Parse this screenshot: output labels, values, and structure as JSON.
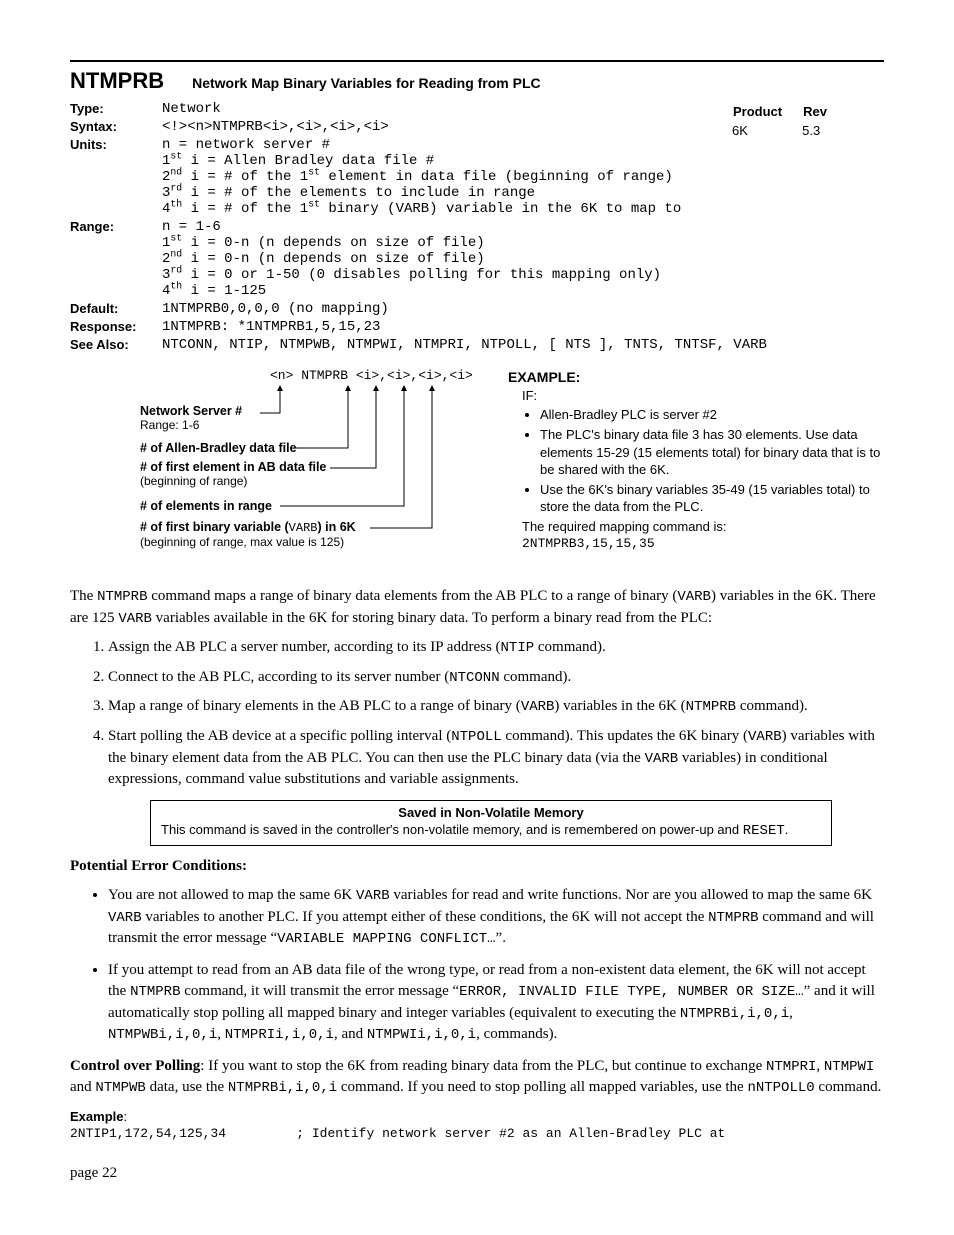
{
  "command": "NTMPRB",
  "title": "Network Map Binary Variables for Reading from PLC",
  "product": {
    "headerP": "Product",
    "headerR": "Rev",
    "prod": "6K",
    "rev": "5.3"
  },
  "spec": {
    "type_label": "Type:",
    "type_val": "Network",
    "syntax_label": "Syntax:",
    "syntax_val": "<!><n>NTMPRB<i>,<i>,<i>,<i>",
    "units_label": "Units:",
    "units_lines": [
      "n = network server #",
      "1st i = Allen Bradley data file #",
      "2nd i = # of the 1st element in data file (beginning of range)",
      "3rd i = # of the elements to include in range",
      "4th i = # of the 1st binary (VARB) variable in the 6K to map to"
    ],
    "range_label": "Range:",
    "range_lines": [
      "n = 1-6",
      "1st i = 0-n (n depends on size of file)",
      "2nd i = 0-n (n depends on size of file)",
      "3rd i = 0 or 1-50 (0 disables polling for this mapping only)",
      "4th i = 1-125"
    ],
    "default_label": "Default:",
    "default_val": "1NTMPRB0,0,0,0 (no mapping)",
    "response_label": "Response:",
    "response_val": "1NTMPRB:  *1NTMPRB1,5,15,23",
    "seealso_label": "See Also:",
    "seealso_val": "NTCONN, NTIP, NTMPWB, NTMPWI, NTMPRI, NTPOLL, [ NTS ], TNTS, TNTSF, VARB"
  },
  "diagram": {
    "syntax": "<n> NTMPRB <i>,<i>,<i>,<i>",
    "l1a": "Network Server #",
    "l1b": "Range: 1-6",
    "l2a": "# of Allen-Bradley data file",
    "l3a": "# of first element in AB data file",
    "l3b": "(beginning of range)",
    "l4a": "# of elements in range",
    "l5a": "# of first binary variable (",
    "l5cmd": "VARB",
    "l5b": ") in 6K",
    "l5c": "(beginning of range, max value is 125)"
  },
  "example": {
    "heading": "EXAMPLE:",
    "if": "IF:",
    "bullets": [
      "Allen-Bradley PLC is server #2",
      "The PLC's binary data file 3 has 30 elements. Use data elements 15-29 (15 elements total) for binary data that is to be shared with the 6K.",
      "Use the 6K's binary variables 35-49 (15 variables total) to store the data from the PLC."
    ],
    "req": "The required mapping command is:",
    "cmd": "2NTMPRB3,15,15,35"
  },
  "intro": {
    "p1a": "The ",
    "p1b": "NTMPRB",
    "p1c": " command maps a range of binary data elements from the AB PLC to a range of binary (",
    "p1d": "VARB",
    "p1e": ") variables in the 6K. There are 125 ",
    "p1f": "VARB",
    "p1g": " variables available in the 6K for storing binary data. To perform a binary read from the PLC:"
  },
  "steps": [
    {
      "a": "Assign the AB PLC a server number, according to its IP address (",
      "b": "NTIP",
      "c": " command)."
    },
    {
      "a": "Connect to the AB PLC, according to its server number (",
      "b": "NTCONN",
      "c": " command)."
    },
    {
      "a": "Map a range of binary elements in the AB PLC to a range of binary (",
      "b": "VARB",
      "c": ") variables in the 6K (",
      "d": "NTMPRB",
      "e": " command)."
    },
    {
      "a": "Start polling the AB device at a specific polling interval (",
      "b": "NTPOLL",
      "c": " command). This updates the 6K binary (",
      "d": "VARB",
      "e": ") variables with the binary element data from the AB PLC. You can then use the PLC binary data (via the ",
      "f": "VARB",
      "g": " variables) in conditional expressions, command value substitutions and variable assignments."
    }
  ],
  "nvbox": {
    "title": "Saved in Non-Volatile Memory",
    "body_a": "This command is saved in the controller's non-volatile memory, and is remembered on power-up and ",
    "body_b": "RESET",
    "body_c": "."
  },
  "errors": {
    "heading": "Potential Error Conditions:",
    "b1": {
      "a": "You are not allowed to map the same 6K ",
      "b": "VARB",
      "c": " variables for read and write functions. Nor are you allowed to map the same 6K ",
      "d": "VARB",
      "e": " variables to another PLC. If you attempt either of these conditions, the 6K will not accept the ",
      "f": "NTMPRB",
      "g": " command and will transmit the error message “",
      "h": "VARIABLE MAPPING CONFLICT…",
      "i": "”."
    },
    "b2": {
      "a": "If you attempt to read from an AB data file of the wrong type, or read from a non-existent data element, the 6K will not accept the ",
      "b": "NTMPRB",
      "c": " command, it will transmit the error message “",
      "d": "ERROR, INVALID FILE TYPE, NUMBER OR SIZE…",
      "e": "” and it will automatically stop polling all mapped binary and integer variables (equivalent to executing the ",
      "f": "NTMPRBi,i,0,i",
      "g": ", ",
      "h": "NTMPWBi,i,0,i",
      "i": ", ",
      "j": "NTMPRIi,i,0,i",
      "k": ", and ",
      "l": "NTMPWIi,i,0,i",
      "m": ", commands)."
    }
  },
  "polling": {
    "lead": "Control over Polling",
    "a": ": If you want to stop the 6K from reading binary data from the PLC, but continue to exchange ",
    "b": "NTMPRI",
    "c": ", ",
    "d": "NTMPWI",
    "e": " and ",
    "f": "NTMPWB",
    "g": " data, use the ",
    "h": "NTMPRBi,i,0,i",
    "i": " command. If you need to stop polling all mapped variables, use the ",
    "j": "nNTPOLL0",
    "k": " command."
  },
  "code_example": {
    "label": "Example",
    "line": "2NTIP1,172,54,125,34",
    "comment": "; Identify network server #2 as an Allen-Bradley PLC at"
  },
  "page": "page 22"
}
